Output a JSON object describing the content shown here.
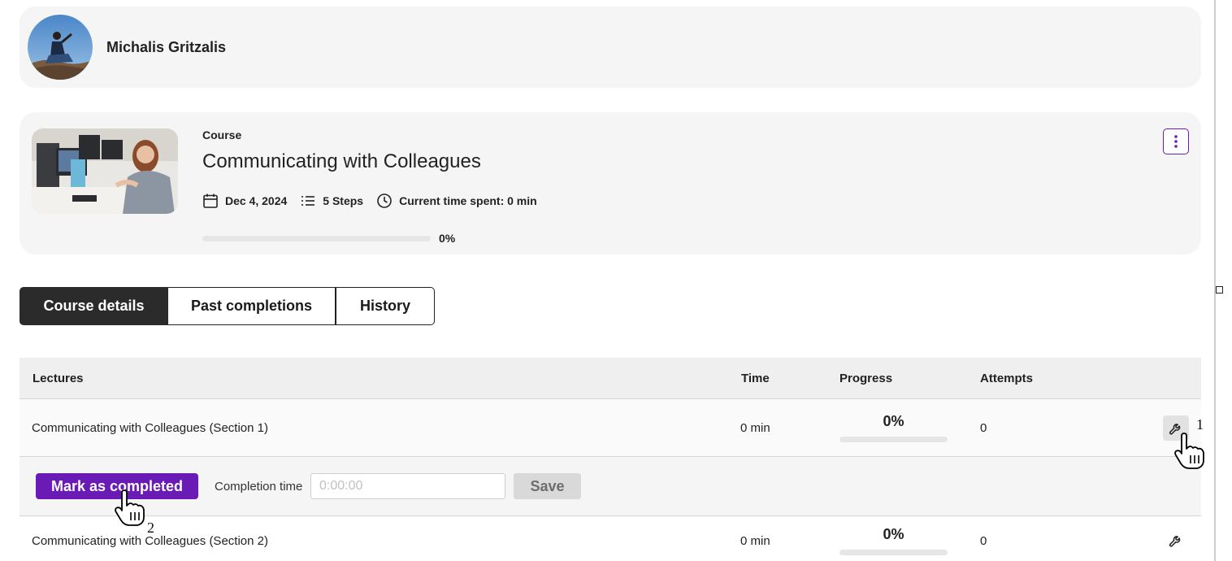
{
  "user": {
    "name": "Michalis Gritzalis"
  },
  "course": {
    "label": "Course",
    "title": "Communicating with Colleagues",
    "date": "Dec 4, 2024",
    "steps": "5 Steps",
    "time_spent": "Current time spent: 0 min",
    "progress_text": "0%",
    "progress_fraction": 0
  },
  "tabs": [
    {
      "label": "Course details",
      "active": true
    },
    {
      "label": "Past completions",
      "active": false
    },
    {
      "label": "History",
      "active": false
    }
  ],
  "table": {
    "headers": {
      "lectures": "Lectures",
      "time": "Time",
      "progress": "Progress",
      "attempts": "Attempts"
    },
    "rows": [
      {
        "lecture": "Communicating with Colleagues (Section 1)",
        "time": "0 min",
        "progress": "0%",
        "attempts": "0"
      },
      {
        "lecture": "Communicating with Colleagues (Section 2)",
        "time": "0 min",
        "progress": "0%",
        "attempts": "0"
      }
    ]
  },
  "expand_panel": {
    "mark_label": "Mark as completed",
    "completion_label": "Completion time",
    "completion_placeholder": "0:00:00",
    "save_label": "Save"
  },
  "annotations": {
    "step1": "1",
    "step2": "2"
  },
  "colors": {
    "accent": "#6a1bb5",
    "card_bg": "#f5f5f5",
    "tab_active": "#2b2b2b"
  },
  "icons": [
    "calendar-icon",
    "list-icon",
    "clock-icon",
    "kebab-menu-icon",
    "wrench-icon",
    "hand-cursor-icon"
  ]
}
